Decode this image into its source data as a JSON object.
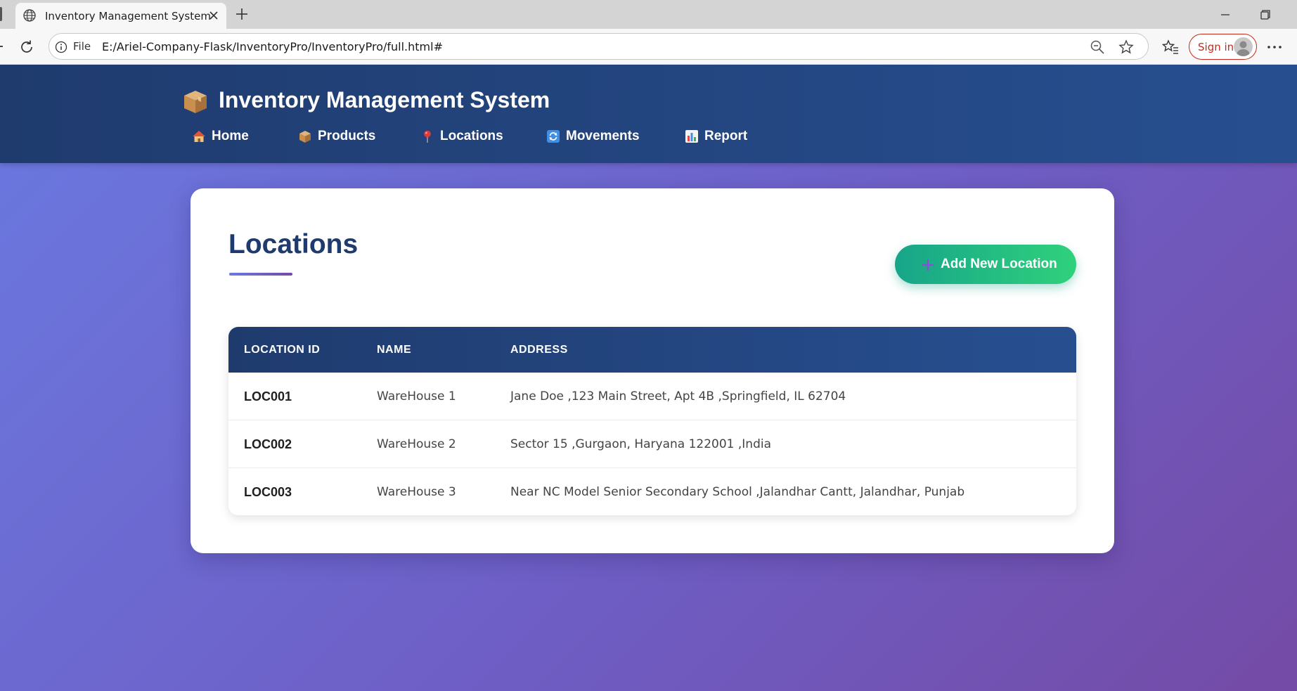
{
  "browser": {
    "tab_title": "Inventory Management System",
    "address_scheme": "File",
    "url": "E:/Ariel-Company-Flask/InventoryPro/InventoryPro/full.html#",
    "signin_label": "Sign in"
  },
  "header": {
    "title": "Inventory Management System",
    "logo_icon": "package-box-icon",
    "nav": [
      {
        "label": "Home",
        "icon": "house-icon"
      },
      {
        "label": "Products",
        "icon": "package-icon"
      },
      {
        "label": "Locations",
        "icon": "pin-icon"
      },
      {
        "label": "Movements",
        "icon": "cycle-arrows-icon"
      },
      {
        "label": "Report",
        "icon": "bar-chart-icon"
      }
    ]
  },
  "main": {
    "title": "Locations",
    "add_button_label": "Add New Location",
    "table": {
      "columns": [
        "LOCATION ID",
        "NAME",
        "ADDRESS"
      ],
      "rows": [
        {
          "id": "LOC001",
          "name": "WareHouse 1",
          "address": "Jane Doe ,123 Main Street, Apt 4B ,Springfield, IL 62704"
        },
        {
          "id": "LOC002",
          "name": "WareHouse 2",
          "address": "Sector 15 ,Gurgaon, Haryana 122001 ,India"
        },
        {
          "id": "LOC003",
          "name": "WareHouse 3",
          "address": "Near NC Model Senior Secondary School ,Jalandhar Cantt, Jalandhar, Punjab"
        }
      ]
    }
  },
  "colors": {
    "header_bg": "#1f3b6e",
    "accent_green": "#2fd17c",
    "title_blue": "#1f3b6e",
    "bg_gradient_start": "#6a79e0",
    "bg_gradient_end": "#744ba6"
  }
}
